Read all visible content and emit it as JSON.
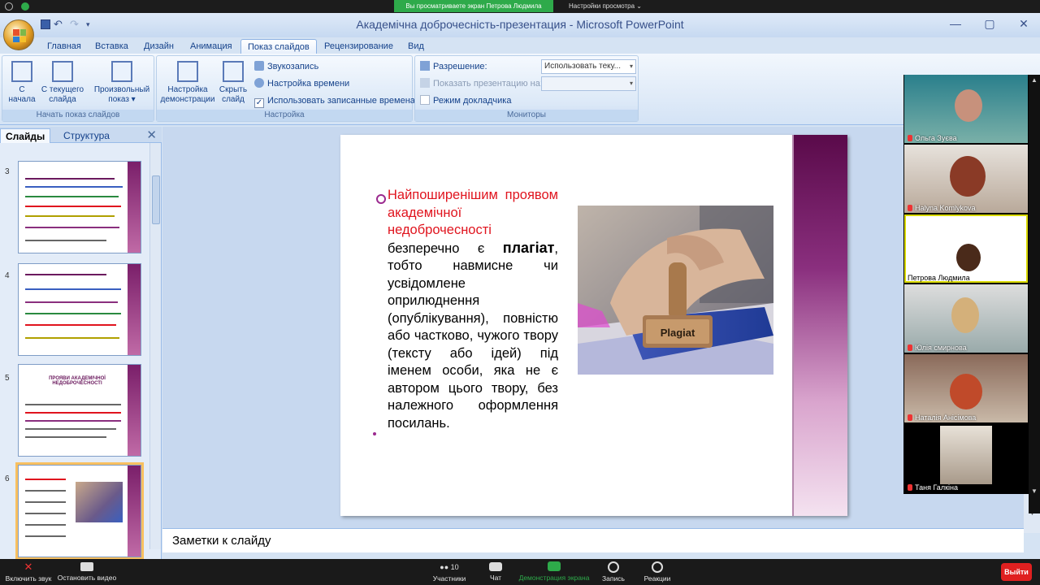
{
  "zoom": {
    "share_banner": "Вы просматриваете экран Петрова Людмила",
    "view_options": "Настройки просмотра ⌄",
    "bottom": {
      "mute": "Включить звук",
      "video": "Остановить видео",
      "participants": "Участники",
      "participants_count": "10",
      "chat": "Чат",
      "share": "Демонстрация экрана",
      "record": "Запись",
      "reactions": "Реакции",
      "end": "Выйти"
    },
    "participants": [
      {
        "name": "Ольга Зуєва"
      },
      {
        "name": "Halyna Komlykova"
      },
      {
        "name": "Петрова Людмила"
      },
      {
        "name": "Юлія смирнова"
      },
      {
        "name": "Наталія Анісімова"
      },
      {
        "name": "Таня Галкіна"
      }
    ]
  },
  "ppt": {
    "title": "Академічна доброчесність-презентация - Microsoft PowerPoint",
    "tabs": [
      "Главная",
      "Вставка",
      "Дизайн",
      "Анимация",
      "Показ слайдов",
      "Рецензирование",
      "Вид"
    ],
    "active_tab": "Показ слайдов",
    "ribbon": {
      "group1": {
        "title": "Начать показ слайдов",
        "b1_l1": "С",
        "b1_l2": "начала",
        "b2_l1": "С текущего",
        "b2_l2": "слайда",
        "b3_l1": "Произвольный",
        "b3_l2": "показ ▾"
      },
      "group2": {
        "title": "Настройка",
        "b1_l1": "Настройка",
        "b1_l2": "демонстрации",
        "b2_l1": "Скрыть",
        "b2_l2": "слайд",
        "s1": "Звукозапись",
        "s2": "Настройка времени",
        "s3": "Использовать записанные времена"
      },
      "group3": {
        "title": "Мониторы",
        "resolution_label": "Разрешение:",
        "resolution_value": "Использовать теку...",
        "show_on_label": "Показать презентацию на:",
        "presenter_view": "Режим докладчика"
      }
    },
    "pane": {
      "tab_slides": "Слайды",
      "tab_outline": "Структура",
      "close": "✕",
      "thumbs": [
        {
          "num": "3"
        },
        {
          "num": "4"
        },
        {
          "num": "5",
          "title": "ПРОЯВИ АКАДЕМІЧНОЇ НЕДОБРОЧЕСНОСТІ"
        },
        {
          "num": "6"
        }
      ]
    },
    "slide": {
      "red_text": "Найпоширенішим проявом академічної недоброчесності",
      "body_pre": "безперечно є ",
      "bold_word": "плагіат",
      "body_post": ", тобто навмисне чи усвідомлене оприлюднення (опублікування), повністю або частково, чужого твору (тексту або ідей) під іменем особи, яка не є автором цього твору, без належного оформлення посилань.",
      "stamp_label": "Plagiat"
    },
    "notes_placeholder": "Заметки к слайду"
  }
}
